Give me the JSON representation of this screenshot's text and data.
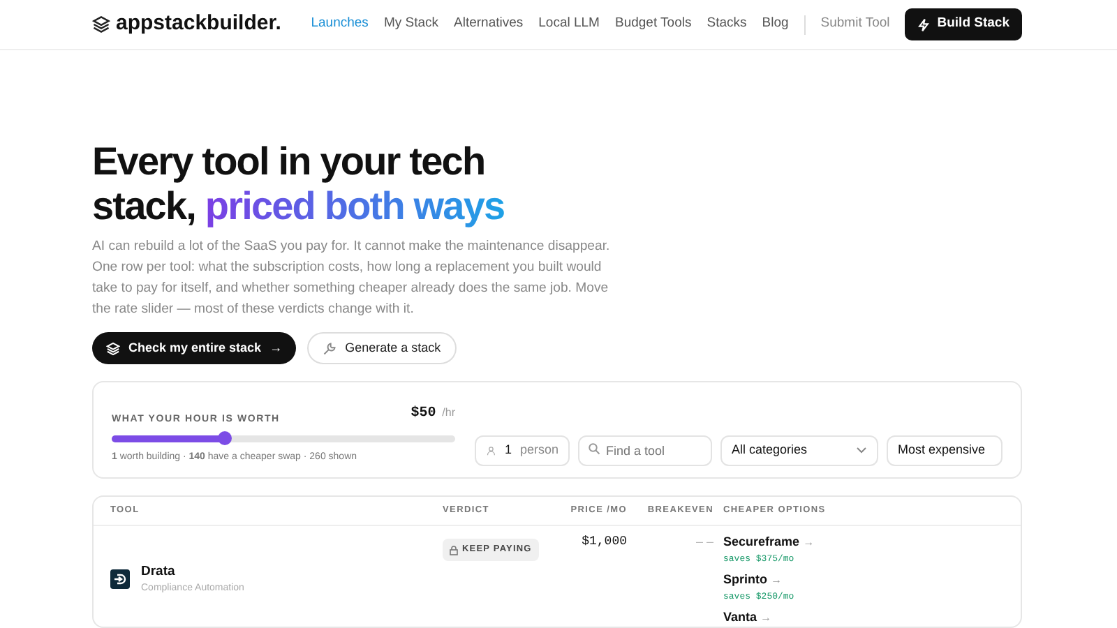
{
  "brand": {
    "name": "appstackbuilder."
  },
  "nav": [
    {
      "label": "Launches",
      "selected": true
    },
    {
      "label": "My Stack",
      "selected": false
    },
    {
      "label": "Alternatives",
      "selected": false
    },
    {
      "label": "Local LLM",
      "selected": false
    },
    {
      "label": "Budget Tools",
      "selected": false
    },
    {
      "label": "Stacks",
      "selected": false
    },
    {
      "label": "Blog",
      "selected": false
    }
  ],
  "submit_link": "Submit Tool",
  "build_button": "Build Stack",
  "hero": {
    "title_plain": "Every tool in your tech stack, ",
    "title_highlight": "priced both ways",
    "description": "AI can rebuild a lot of the SaaS you pay for. It cannot make the maintenance disappear. One row per tool: what the subscription costs, how long a replacement you built would take to pay for itself, and whether something cheaper already does the same job. Move the rate slider — most of these verdicts change with it.",
    "primary_button": "Check my entire stack",
    "arrow": "→",
    "secondary_button": "Generate a stack"
  },
  "filters": {
    "rate_label": "WHAT YOUR HOUR IS WORTH",
    "rate_value": "$50",
    "rate_unit": "/hr",
    "rate_slider": {
      "level": 0.33
    },
    "summary": "**1** worth building · **140** have a cheaper swap · 260 shown",
    "people_value": "1",
    "people_unit": "person",
    "search_placeholder": "Find a tool",
    "category": "All categories",
    "sort": "Most expensive"
  },
  "table": {
    "columns": [
      "TOOL",
      "VERDICT",
      "PRICE /MO",
      "BREAKEVEN",
      "CHEAPER OPTIONS"
    ],
    "rows": [
      {
        "name": "Drata",
        "category": "Compliance Automation",
        "verdict": "KEEP PAYING",
        "price": "$1,000",
        "breakeven": "– –",
        "options": [
          {
            "name": "Secureframe",
            "arrow": "→",
            "saves": "saves $375/mo"
          },
          {
            "name": "Sprinto",
            "arrow": "→",
            "saves": "saves $250/mo"
          },
          {
            "name": "Vanta",
            "arrow": "→"
          }
        ]
      }
    ]
  }
}
